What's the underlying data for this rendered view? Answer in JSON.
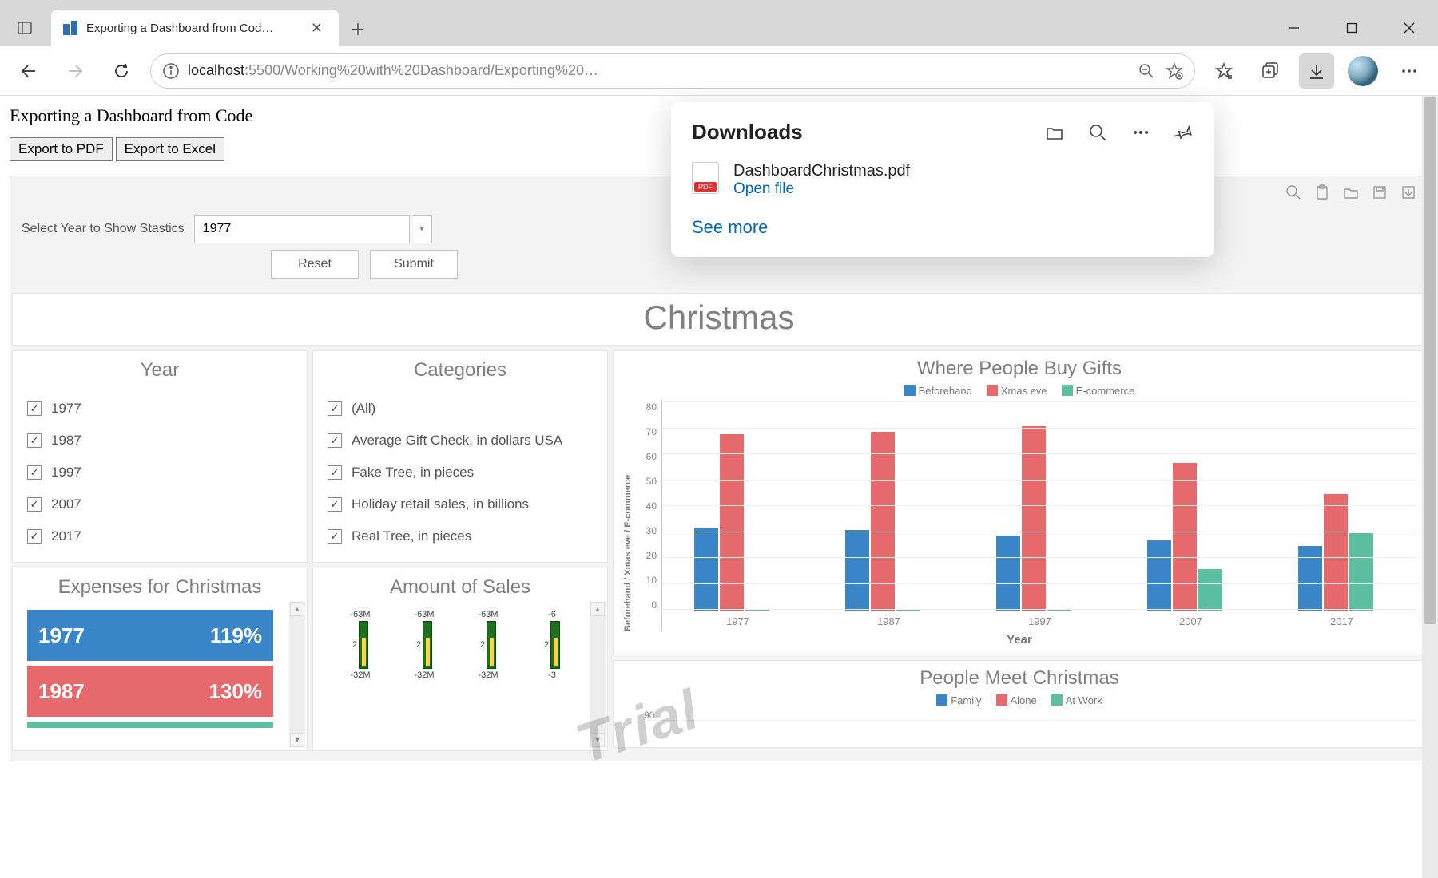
{
  "browser": {
    "tab_title": "Exporting a Dashboard from Cod…",
    "url_display_scheme": "localhost",
    "url_display_path": ":5500/Working%20with%20Dashboard/Exporting%20…"
  },
  "page": {
    "heading": "Exporting a Dashboard from Code",
    "btn_export_pdf": "Export to PDF",
    "btn_export_excel": "Export to Excel"
  },
  "filter": {
    "label": "Select Year to Show Stastics",
    "value": "1977",
    "btn_reset": "Reset",
    "btn_submit": "Submit"
  },
  "dashboard": {
    "title": "Christmas",
    "watermark": "Trial",
    "year_panel_title": "Year",
    "years": [
      "1977",
      "1987",
      "1997",
      "2007",
      "2017"
    ],
    "categories_panel_title": "Categories",
    "categories": [
      "(All)",
      "Average Gift Check, in dollars USA",
      "Fake Tree, in pieces",
      "Holiday retail sales, in billions",
      "Real Tree, in pieces"
    ],
    "expenses_title": "Expenses for Christmas",
    "expenses": [
      {
        "year": "1977",
        "pct": "119%"
      },
      {
        "year": "1987",
        "pct": "130%"
      }
    ],
    "sales_title": "Amount of Sales",
    "sales_high_label": "-63M",
    "sales_low_label": "-32M",
    "sales_tick_mid": "2",
    "chart1_title": "Where People Buy Gifts",
    "chart1_legend": [
      "Beforehand",
      "Xmas eve",
      "E-commerce"
    ],
    "chart1_ylabel": "Beforehand / Xmas eve / E-commerce",
    "chart1_xlabel": "Year",
    "chart2_title": "People Meet Christmas",
    "chart2_legend": [
      "Family",
      "Alone",
      "At Work"
    ],
    "chart2_y_tick": "90"
  },
  "downloads": {
    "title": "Downloads",
    "file_name": "DashboardChristmas.pdf",
    "open_label": "Open file",
    "see_more": "See more"
  },
  "chart_data": {
    "type": "bar",
    "title": "Where People Buy Gifts",
    "categories": [
      "1977",
      "1987",
      "1997",
      "2007",
      "2017"
    ],
    "series": [
      {
        "name": "Beforehand",
        "values": [
          32,
          31,
          29,
          27,
          25
        ]
      },
      {
        "name": "Xmas eve",
        "values": [
          68,
          69,
          71,
          57,
          45
        ]
      },
      {
        "name": "E-commerce",
        "values": [
          0,
          0,
          0,
          16,
          30
        ]
      }
    ],
    "ylabel": "Beforehand / Xmas eve / E-commerce",
    "xlabel": "Year",
    "ylim": [
      0,
      80
    ],
    "y_ticks": [
      0,
      10,
      20,
      30,
      40,
      50,
      60,
      70,
      80
    ]
  }
}
